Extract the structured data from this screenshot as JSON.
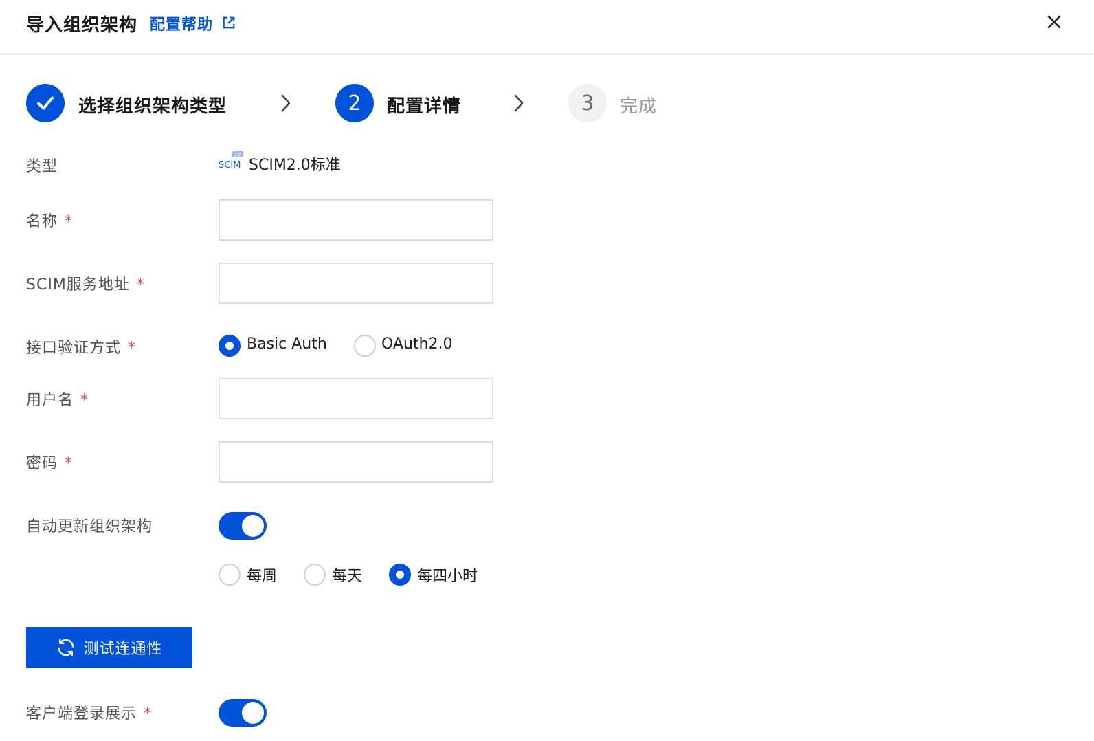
{
  "header": {
    "title": "导入组织架构",
    "help_link": "配置帮助"
  },
  "steps": [
    {
      "label": "选择组织架构类型",
      "status": "done"
    },
    {
      "number": "2",
      "label": "配置详情",
      "status": "active"
    },
    {
      "number": "3",
      "label": "完成",
      "status": "pending"
    }
  ],
  "form": {
    "type": {
      "label": "类型",
      "logo_text": "SCIM",
      "logo_badge": "2.0",
      "value": "SCIM2.0标准"
    },
    "name": {
      "label": "名称",
      "required": "*",
      "value": ""
    },
    "scim_url": {
      "label": "SCIM服务地址",
      "required": "*",
      "value": ""
    },
    "auth_method": {
      "label": "接口验证方式",
      "required": "*",
      "options": [
        "Basic Auth",
        "OAuth2.0"
      ],
      "selected": "Basic Auth"
    },
    "username": {
      "label": "用户名",
      "required": "*",
      "value": ""
    },
    "password": {
      "label": "密码",
      "required": "*",
      "value": ""
    },
    "auto_update": {
      "label": "自动更新组织架构",
      "enabled": true,
      "frequency_options": [
        "每周",
        "每天",
        "每四小时"
      ],
      "frequency_selected": "每四小时"
    },
    "test_button": "测试连通性",
    "client_login": {
      "label": "客户端登录展示",
      "required": "*",
      "enabled": true
    }
  },
  "colors": {
    "primary": "#0052d9",
    "required": "#e34d59",
    "border": "#dcdcdc"
  }
}
